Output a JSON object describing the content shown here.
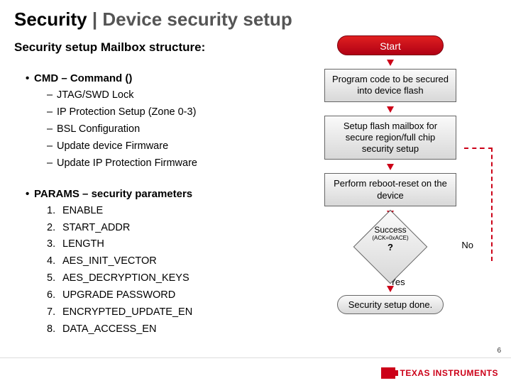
{
  "title_bold": "Security",
  "title_sep": " | ",
  "title_rest": "Device security setup",
  "subtitle": "Security setup Mailbox structure:",
  "cmd_head": "CMD – Command ()",
  "cmd_items": [
    "JTAG/SWD Lock",
    "IP Protection Setup (Zone 0-3)",
    "BSL Configuration",
    "Update device Firmware",
    "Update IP Protection Firmware"
  ],
  "params_head": "PARAMS – security parameters",
  "params_items": [
    "ENABLE",
    "START_ADDR",
    "LENGTH",
    "AES_INIT_VECTOR",
    "AES_DECRYPTION_KEYS",
    "UPGRADE PASSWORD",
    "ENCRYPTED_UPDATE_EN",
    "DATA_ACCESS_EN"
  ],
  "flow": {
    "start": "Start",
    "step1": "Program code to be secured into device flash",
    "step2": "Setup flash mailbox for secure region/full chip security setup",
    "step3": "Perform reboot-reset on the device",
    "decision_main": "Success",
    "decision_small": "(ACK=0xACE)",
    "decision_q": "?",
    "yes": "Yes",
    "no": "No",
    "done": "Security setup done."
  },
  "page_number": "6",
  "brand": "TEXAS INSTRUMENTS"
}
